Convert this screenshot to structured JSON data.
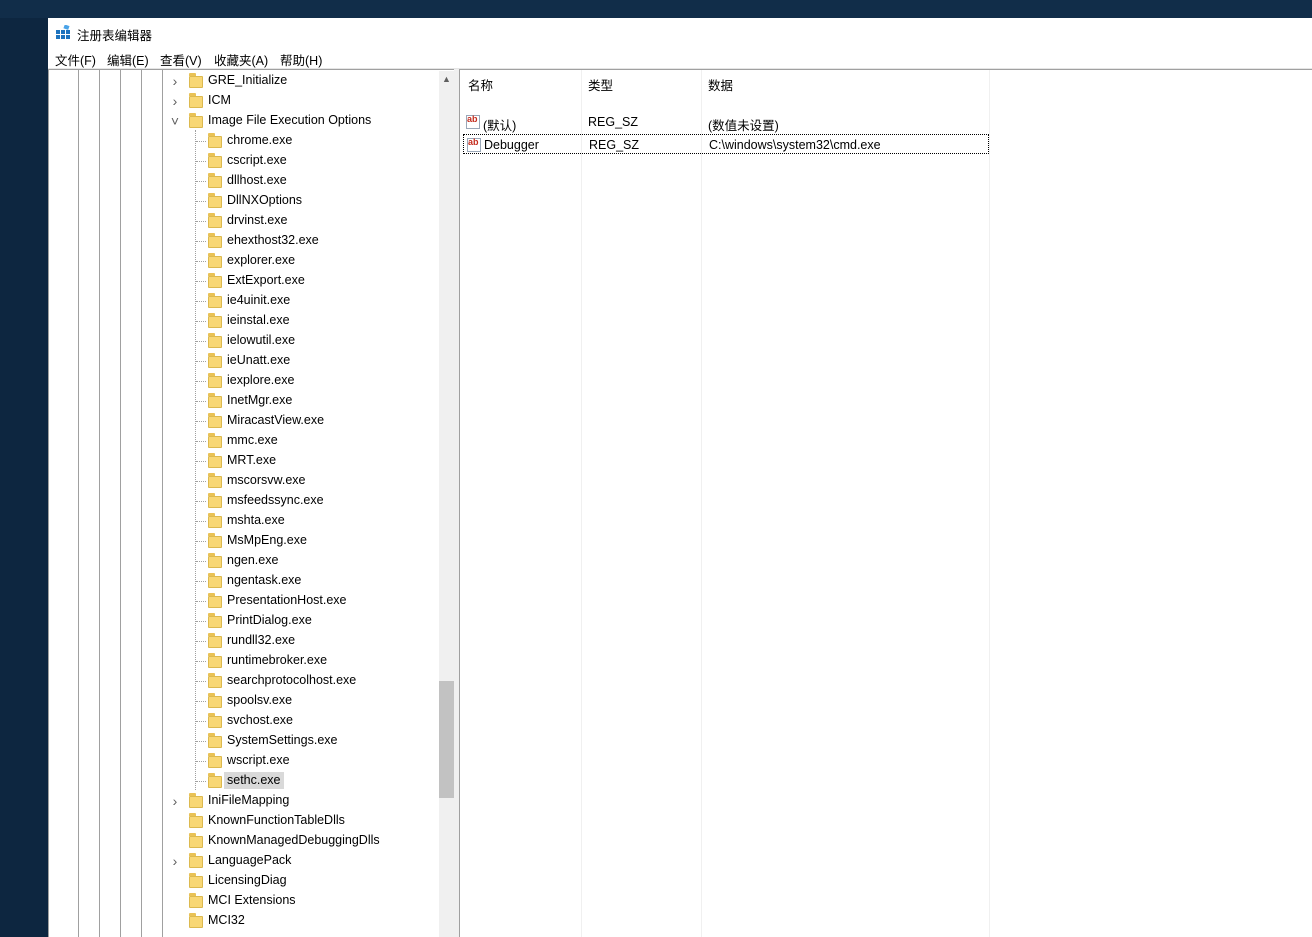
{
  "window": {
    "title": "注册表编辑器",
    "icon": "regedit-icon"
  },
  "menu": [
    "文件(F)",
    "编辑(E)",
    "查看(V)",
    "收藏夹(A)",
    "帮助(H)"
  ],
  "tree": {
    "nodes": [
      {
        "label": "GRE_Initialize",
        "level": 1,
        "expander": "collapsed"
      },
      {
        "label": "ICM",
        "level": 1,
        "expander": "collapsed"
      },
      {
        "label": "Image File Execution Options",
        "level": 1,
        "expander": "expanded"
      },
      {
        "label": "chrome.exe",
        "level": 2,
        "expander": "none"
      },
      {
        "label": "cscript.exe",
        "level": 2,
        "expander": "none"
      },
      {
        "label": "dllhost.exe",
        "level": 2,
        "expander": "none"
      },
      {
        "label": "DllNXOptions",
        "level": 2,
        "expander": "none"
      },
      {
        "label": "drvinst.exe",
        "level": 2,
        "expander": "none"
      },
      {
        "label": "ehexthost32.exe",
        "level": 2,
        "expander": "none"
      },
      {
        "label": "explorer.exe",
        "level": 2,
        "expander": "none"
      },
      {
        "label": "ExtExport.exe",
        "level": 2,
        "expander": "none"
      },
      {
        "label": "ie4uinit.exe",
        "level": 2,
        "expander": "none"
      },
      {
        "label": "ieinstal.exe",
        "level": 2,
        "expander": "none"
      },
      {
        "label": "ielowutil.exe",
        "level": 2,
        "expander": "none"
      },
      {
        "label": "ieUnatt.exe",
        "level": 2,
        "expander": "none"
      },
      {
        "label": "iexplore.exe",
        "level": 2,
        "expander": "none"
      },
      {
        "label": "InetMgr.exe",
        "level": 2,
        "expander": "none"
      },
      {
        "label": "MiracastView.exe",
        "level": 2,
        "expander": "none"
      },
      {
        "label": "mmc.exe",
        "level": 2,
        "expander": "none"
      },
      {
        "label": "MRT.exe",
        "level": 2,
        "expander": "none"
      },
      {
        "label": "mscorsvw.exe",
        "level": 2,
        "expander": "none"
      },
      {
        "label": "msfeedssync.exe",
        "level": 2,
        "expander": "none"
      },
      {
        "label": "mshta.exe",
        "level": 2,
        "expander": "none"
      },
      {
        "label": "MsMpEng.exe",
        "level": 2,
        "expander": "none"
      },
      {
        "label": "ngen.exe",
        "level": 2,
        "expander": "none"
      },
      {
        "label": "ngentask.exe",
        "level": 2,
        "expander": "none"
      },
      {
        "label": "PresentationHost.exe",
        "level": 2,
        "expander": "none"
      },
      {
        "label": "PrintDialog.exe",
        "level": 2,
        "expander": "none"
      },
      {
        "label": "rundll32.exe",
        "level": 2,
        "expander": "none"
      },
      {
        "label": "runtimebroker.exe",
        "level": 2,
        "expander": "none"
      },
      {
        "label": "searchprotocolhost.exe",
        "level": 2,
        "expander": "none"
      },
      {
        "label": "spoolsv.exe",
        "level": 2,
        "expander": "none"
      },
      {
        "label": "svchost.exe",
        "level": 2,
        "expander": "none"
      },
      {
        "label": "SystemSettings.exe",
        "level": 2,
        "expander": "none"
      },
      {
        "label": "wscript.exe",
        "level": 2,
        "expander": "none"
      },
      {
        "label": "sethc.exe",
        "level": 2,
        "expander": "none",
        "selected": true
      },
      {
        "label": "IniFileMapping",
        "level": 1,
        "expander": "collapsed"
      },
      {
        "label": "KnownFunctionTableDlls",
        "level": 1,
        "expander": "none"
      },
      {
        "label": "KnownManagedDebuggingDlls",
        "level": 1,
        "expander": "none"
      },
      {
        "label": "LanguagePack",
        "level": 1,
        "expander": "collapsed"
      },
      {
        "label": "LicensingDiag",
        "level": 1,
        "expander": "none"
      },
      {
        "label": "MCI Extensions",
        "level": 1,
        "expander": "none"
      },
      {
        "label": "MCI32",
        "level": 1,
        "expander": "none"
      }
    ]
  },
  "values_pane": {
    "columns": {
      "name": "名称",
      "type": "类型",
      "data": "数据"
    },
    "rows": [
      {
        "name": "(默认)",
        "type": "REG_SZ",
        "data": "(数值未设置)",
        "icon": "string-value-icon"
      },
      {
        "name": "Debugger",
        "type": "REG_SZ",
        "data": "C:\\windows\\system32\\cmd.exe",
        "icon": "string-value-icon",
        "focused": true
      }
    ]
  }
}
